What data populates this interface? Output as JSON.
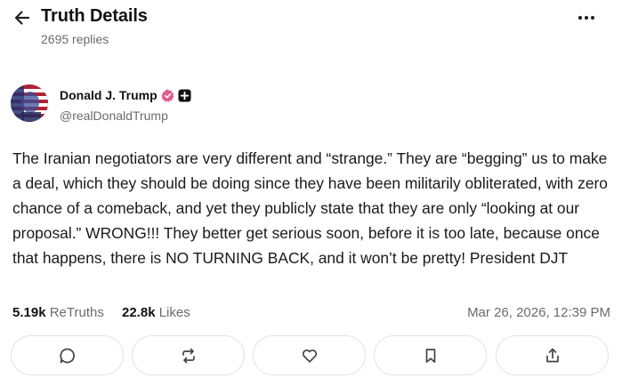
{
  "header": {
    "title": "Truth Details",
    "replies": "2695 replies",
    "back_icon": "arrow-left-icon",
    "more_icon": "more-horizontal-icon"
  },
  "author": {
    "name": "Donald J. Trump",
    "handle": "@realDonaldTrump",
    "verified_color": "#e45a8c"
  },
  "post": {
    "text": "The Iranian negotiators are very different and “strange.” They are “begging” us to make a deal, which they should be doing since they have been militarily obliterated, with zero chance of a comeback, and yet they publicly state that they are only “looking at our proposal.” WRONG!!! They better get serious soon, before it is too late, because once that happens, there is NO TURNING BACK, and it won’t be pretty! President DJT"
  },
  "stats": {
    "retruths_count": "5.19k",
    "retruths_label": "ReTruths",
    "likes_count": "22.8k",
    "likes_label": "Likes",
    "timestamp": "Mar 26, 2026, 12:39 PM"
  },
  "actions": [
    {
      "name": "reply",
      "icon": "comment-icon"
    },
    {
      "name": "retruth",
      "icon": "repost-icon"
    },
    {
      "name": "like",
      "icon": "heart-icon"
    },
    {
      "name": "bookmark",
      "icon": "bookmark-icon"
    },
    {
      "name": "share",
      "icon": "share-icon"
    }
  ]
}
